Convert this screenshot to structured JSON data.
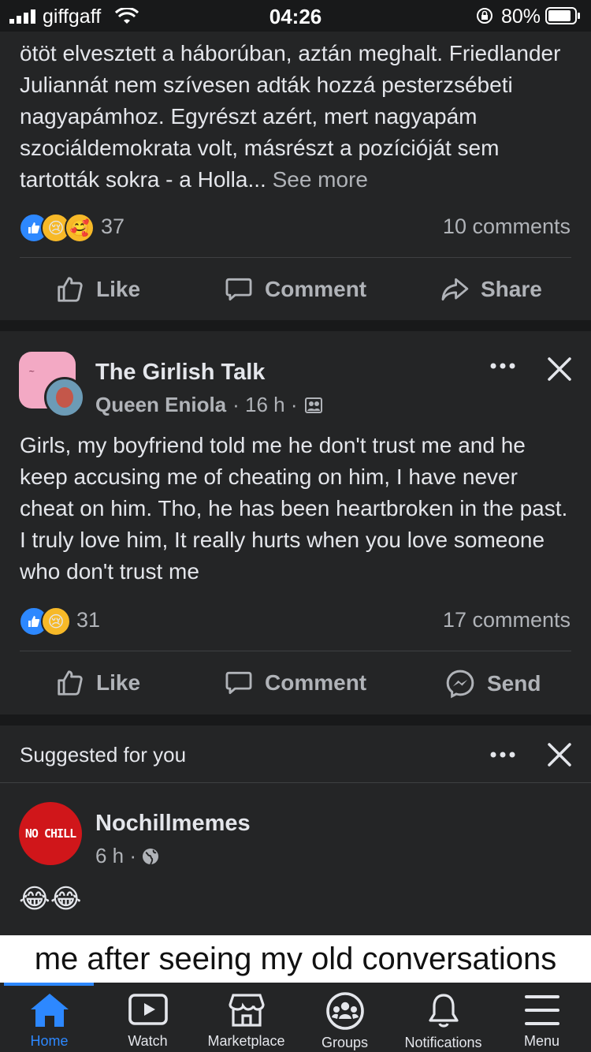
{
  "status_bar": {
    "carrier": "giffgaff",
    "time": "04:26",
    "battery": "80%"
  },
  "post1": {
    "text": "ötöt elvesztett a háborúban, aztán meghalt. Friedlander Juliannát nem szívesen adták hozzá pesterzsébeti nagyapámhoz. Egyrészt azért, mert nagyapám szociáldemokrata volt, másrészt a pozícióját sem tartották sokra -  a Holla...",
    "see_more": "See more",
    "reaction_count": "37",
    "comments": "10 comments",
    "actions": {
      "like": "Like",
      "comment": "Comment",
      "share": "Share"
    }
  },
  "post2": {
    "page_name": "The Girlish Talk",
    "author": "Queen Eniola",
    "meta": "· 16 h ·",
    "text": "Girls, my boyfriend told me he don't trust me and he keep accusing me of cheating on him, I have never cheat on him. Tho, he has been heartbroken in the past. I truly love him, It really hurts when you love someone who don't trust me",
    "reaction_count": "31",
    "comments": "17 comments",
    "actions": {
      "like": "Like",
      "comment": "Comment",
      "send": "Send"
    }
  },
  "suggested": {
    "header": "Suggested for you",
    "page_name": "Nochillmemes",
    "avatar_text": "NO CHILL",
    "time": "6 h ·",
    "emoji_text": "😂😂",
    "meme_caption": "me after seeing my old conversations"
  },
  "bottom_nav": [
    {
      "label": "Home",
      "active": true
    },
    {
      "label": "Watch"
    },
    {
      "label": "Marketplace"
    },
    {
      "label": "Groups"
    },
    {
      "label": "Notifications"
    },
    {
      "label": "Menu"
    }
  ],
  "colors": {
    "background": "#18191a",
    "card": "#242526",
    "accent": "#2d88ff",
    "muted": "#b0b3b8"
  }
}
